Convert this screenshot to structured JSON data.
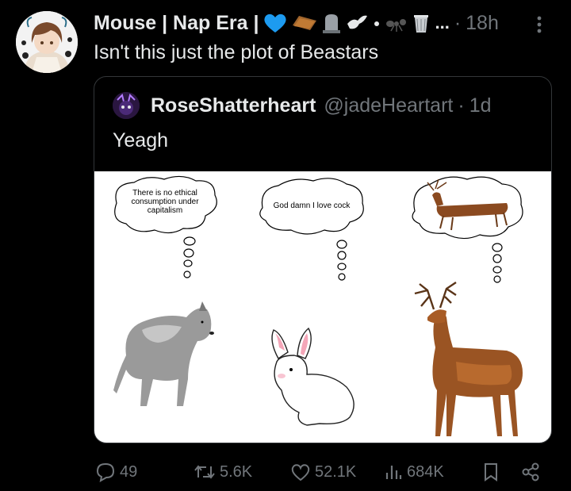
{
  "tweet": {
    "display_name": "Mouse | Nap Era |",
    "name_overflow": "...",
    "separator": "·",
    "time": "18h",
    "text": "Isn't this just the plot of Beastars"
  },
  "quote": {
    "display_name": "RoseShatterheart",
    "handle": "@jadeHeartart",
    "separator": "·",
    "time": "1d",
    "text": "Yeagh",
    "meme": {
      "bubble_wolf": "There is no ethical consumption under capitalism",
      "bubble_rabbit": "God damn I love cock"
    }
  },
  "actions": {
    "replies": "49",
    "reposts": "5.6K",
    "likes": "52.1K",
    "views": "684K"
  },
  "colors": {
    "background": "#000000",
    "text_primary": "#e7e9ea",
    "text_secondary": "#71767b",
    "border": "#333639",
    "heart_blue": "#1d9bf0"
  },
  "icons": [
    "more-icon",
    "reply-icon",
    "repost-icon",
    "like-icon",
    "views-icon",
    "bookmark-icon",
    "share-icon"
  ]
}
